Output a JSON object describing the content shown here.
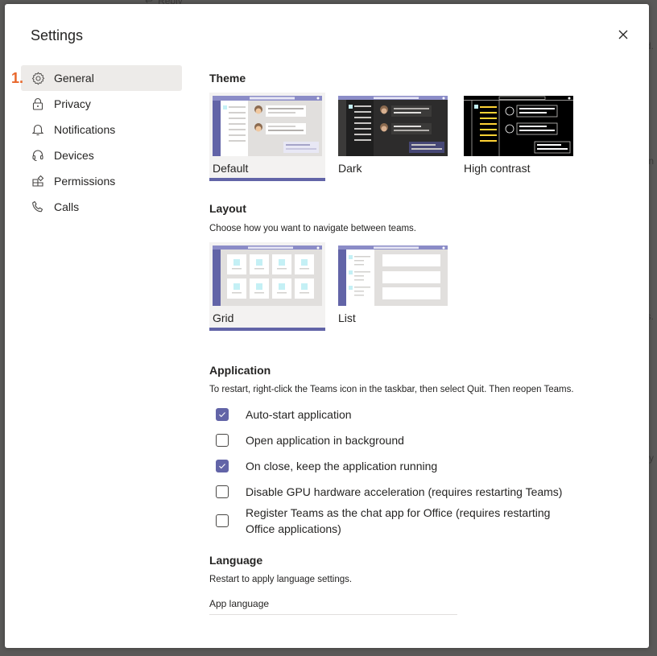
{
  "background": {
    "reply_label": "Reply",
    "fragments": [
      "d.",
      "n",
      "es.",
      "y"
    ]
  },
  "dialog": {
    "title": "Settings",
    "close_icon": "close-icon"
  },
  "annotation": {
    "step_marker": "1."
  },
  "sidebar": {
    "items": [
      {
        "label": "General",
        "icon": "gear-icon",
        "active": true
      },
      {
        "label": "Privacy",
        "icon": "lock-icon",
        "active": false
      },
      {
        "label": "Notifications",
        "icon": "bell-icon",
        "active": false
      },
      {
        "label": "Devices",
        "icon": "headset-icon",
        "active": false
      },
      {
        "label": "Permissions",
        "icon": "apps-icon",
        "active": false
      },
      {
        "label": "Calls",
        "icon": "phone-icon",
        "active": false
      }
    ]
  },
  "theme": {
    "heading": "Theme",
    "options": [
      {
        "label": "Default",
        "selected": true
      },
      {
        "label": "Dark",
        "selected": false
      },
      {
        "label": "High contrast",
        "selected": false
      }
    ]
  },
  "layout": {
    "heading": "Layout",
    "description": "Choose how you want to navigate between teams.",
    "options": [
      {
        "label": "Grid",
        "selected": true
      },
      {
        "label": "List",
        "selected": false
      }
    ]
  },
  "application": {
    "heading": "Application",
    "description": "To restart, right-click the Teams icon in the taskbar, then select Quit. Then reopen Teams.",
    "checkboxes": [
      {
        "label": "Auto-start application",
        "checked": true
      },
      {
        "label": "Open application in background",
        "checked": false
      },
      {
        "label": "On close, keep the application running",
        "checked": true
      },
      {
        "label": "Disable GPU hardware acceleration (requires restarting Teams)",
        "checked": false
      },
      {
        "label": "Register Teams as the chat app for Office (requires restarting Office applications)",
        "checked": false
      }
    ]
  },
  "language": {
    "heading": "Language",
    "description": "Restart to apply language settings.",
    "app_language_label": "App language"
  },
  "colors": {
    "accent": "#6264a7",
    "step_marker": "#e8662a",
    "selected_bg": "#f3f2f1",
    "nav_active_bg": "#edebe9"
  }
}
